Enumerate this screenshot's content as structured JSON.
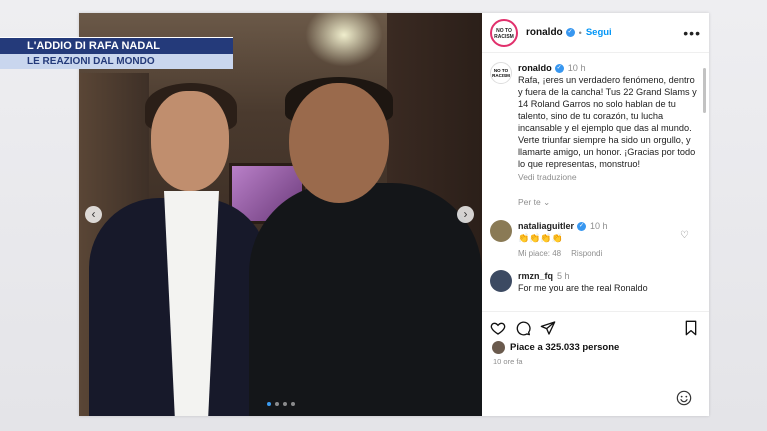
{
  "ticker": {
    "line1": "L'ADDIO DI RAFA NADAL",
    "line2": "LE REAZIONI DAL MONDO"
  },
  "post": {
    "username": "ronaldo",
    "follow_label": "Segui",
    "more_icon": "more-icon",
    "avatar_logo": "NO TO RACISM",
    "caption": {
      "username": "ronaldo",
      "time": "10 h",
      "text": "Rafa, ¡eres un verdadero fenómeno, dentro y fuera de la cancha! Tus 22 Grand Slams y 14 Roland Garros no solo hablan de tu talento, sino de tu corazón, tu lucha incansable y el ejemplo que das al mundo. Verte triunfar siempre ha sido un orgullo, y llamarte amigo, un honor. ¡Gracias por todo lo que representas, monstruo!",
      "translate_label": "Vedi traduzione"
    },
    "for_you_label": "Per te",
    "comments": [
      {
        "user": "nataliaguitler",
        "time": "10 h",
        "text": "👏👏👏👏",
        "likes": "Mi piace: 48",
        "reply": "Rispondi"
      },
      {
        "user": "rmzn_fq",
        "time": "5 h",
        "text": "For me you are the real Ronaldo"
      }
    ],
    "likes_text": "Piace a 325.033 persone",
    "posted_ago": "10 ore fa",
    "carousel": {
      "current": 1,
      "total": 4
    }
  }
}
